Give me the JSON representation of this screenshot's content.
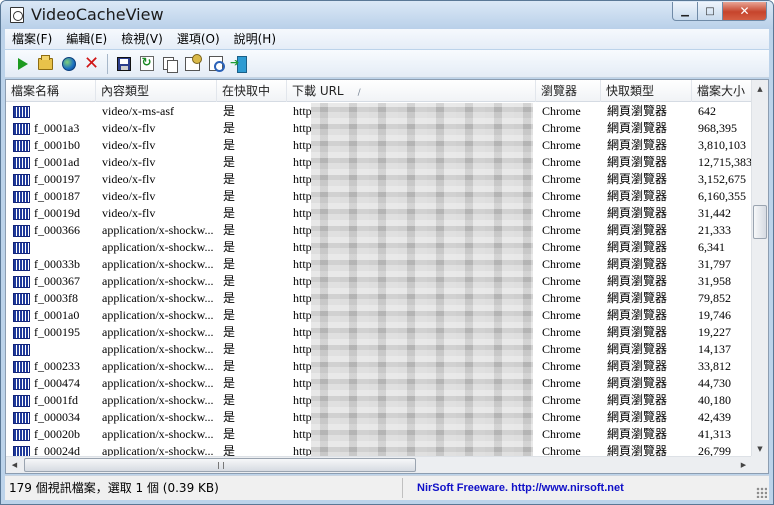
{
  "window": {
    "title": "VideoCacheView",
    "minimize_glyph": "▁",
    "maximize_glyph": "□",
    "close_glyph": "✕"
  },
  "menu": [
    "檔案(F)",
    "編輯(E)",
    "檢視(V)",
    "選項(O)",
    "說明(H)"
  ],
  "toolbar": {
    "icons": [
      "play-icon",
      "open-folder-icon",
      "globe-icon",
      "delete-icon",
      "save-icon",
      "refresh-icon",
      "copy-icon",
      "properties-icon",
      "find-icon",
      "exit-icon"
    ]
  },
  "columns": [
    "檔案名稱",
    "內容類型",
    "在快取中",
    "下載 URL",
    "瀏覽器",
    "快取類型",
    "檔案大小"
  ],
  "sort_indicator": "/",
  "rows": [
    {
      "name": "",
      "type": "video/x-ms-asf",
      "cached": "是",
      "url": "http://",
      "browser": "Chrome",
      "cache_type": "網頁瀏覽器",
      "size": "642"
    },
    {
      "name": "f_0001a3",
      "type": "video/x-flv",
      "cached": "是",
      "url": "http://",
      "browser": "Chrome",
      "cache_type": "網頁瀏覽器",
      "size": "968,395"
    },
    {
      "name": "f_0001b0",
      "type": "video/x-flv",
      "cached": "是",
      "url": "http://",
      "browser": "Chrome",
      "cache_type": "網頁瀏覽器",
      "size": "3,810,103"
    },
    {
      "name": "f_0001ad",
      "type": "video/x-flv",
      "cached": "是",
      "url": "http://",
      "browser": "Chrome",
      "cache_type": "網頁瀏覽器",
      "size": "12,715,383"
    },
    {
      "name": "f_000197",
      "type": "video/x-flv",
      "cached": "是",
      "url": "http://",
      "browser": "Chrome",
      "cache_type": "網頁瀏覽器",
      "size": "3,152,675"
    },
    {
      "name": "f_000187",
      "type": "video/x-flv",
      "cached": "是",
      "url": "http://",
      "browser": "Chrome",
      "cache_type": "網頁瀏覽器",
      "size": "6,160,355"
    },
    {
      "name": "f_00019d",
      "type": "video/x-flv",
      "cached": "是",
      "url": "http://",
      "browser": "Chrome",
      "cache_type": "網頁瀏覽器",
      "size": "31,442"
    },
    {
      "name": "f_000366",
      "type": "application/x-shockw...",
      "cached": "是",
      "url": "http://",
      "browser": "Chrome",
      "cache_type": "網頁瀏覽器",
      "size": "21,333"
    },
    {
      "name": "",
      "type": "application/x-shockw...",
      "cached": "是",
      "url": "http://",
      "browser": "Chrome",
      "cache_type": "網頁瀏覽器",
      "size": "6,341"
    },
    {
      "name": "f_00033b",
      "type": "application/x-shockw...",
      "cached": "是",
      "url": "http://",
      "browser": "Chrome",
      "cache_type": "網頁瀏覽器",
      "size": "31,797"
    },
    {
      "name": "f_000367",
      "type": "application/x-shockw...",
      "cached": "是",
      "url": "http://",
      "browser": "Chrome",
      "cache_type": "網頁瀏覽器",
      "size": "31,958"
    },
    {
      "name": "f_0003f8",
      "type": "application/x-shockw...",
      "cached": "是",
      "url": "http://",
      "browser": "Chrome",
      "cache_type": "網頁瀏覽器",
      "size": "79,852"
    },
    {
      "name": "f_0001a0",
      "type": "application/x-shockw...",
      "cached": "是",
      "url": "http://",
      "browser": "Chrome",
      "cache_type": "網頁瀏覽器",
      "size": "19,746"
    },
    {
      "name": "f_000195",
      "type": "application/x-shockw...",
      "cached": "是",
      "url": "http://",
      "browser": "Chrome",
      "cache_type": "網頁瀏覽器",
      "size": "19,227"
    },
    {
      "name": "",
      "type": "application/x-shockw...",
      "cached": "是",
      "url": "http://",
      "browser": "Chrome",
      "cache_type": "網頁瀏覽器",
      "size": "14,137"
    },
    {
      "name": "f_000233",
      "type": "application/x-shockw...",
      "cached": "是",
      "url": "http://",
      "browser": "Chrome",
      "cache_type": "網頁瀏覽器",
      "size": "33,812"
    },
    {
      "name": "f_000474",
      "type": "application/x-shockw...",
      "cached": "是",
      "url": "http://",
      "browser": "Chrome",
      "cache_type": "網頁瀏覽器",
      "size": "44,730"
    },
    {
      "name": "f_0001fd",
      "type": "application/x-shockw...",
      "cached": "是",
      "url": "http://",
      "browser": "Chrome",
      "cache_type": "網頁瀏覽器",
      "size": "40,180"
    },
    {
      "name": "f_000034",
      "type": "application/x-shockw...",
      "cached": "是",
      "url": "http://",
      "browser": "Chrome",
      "cache_type": "網頁瀏覽器",
      "size": "42,439"
    },
    {
      "name": "f_00020b",
      "type": "application/x-shockw...",
      "cached": "是",
      "url": "http://",
      "browser": "Chrome",
      "cache_type": "網頁瀏覽器",
      "size": "41,313"
    },
    {
      "name": "f_00024d",
      "type": "application/x-shockw...",
      "cached": "是",
      "url": "http://",
      "browser": "Chrome",
      "cache_type": "網頁瀏覽器",
      "size": "26,799"
    }
  ],
  "status": {
    "summary": "179 個視訊檔案，選取 1 個  (0.39 KB)",
    "credit": "NirSoft Freeware.  http://www.nirsoft.net"
  },
  "colors": {
    "status_link": "#1010c8",
    "file_icon": "#1f3a9b"
  }
}
